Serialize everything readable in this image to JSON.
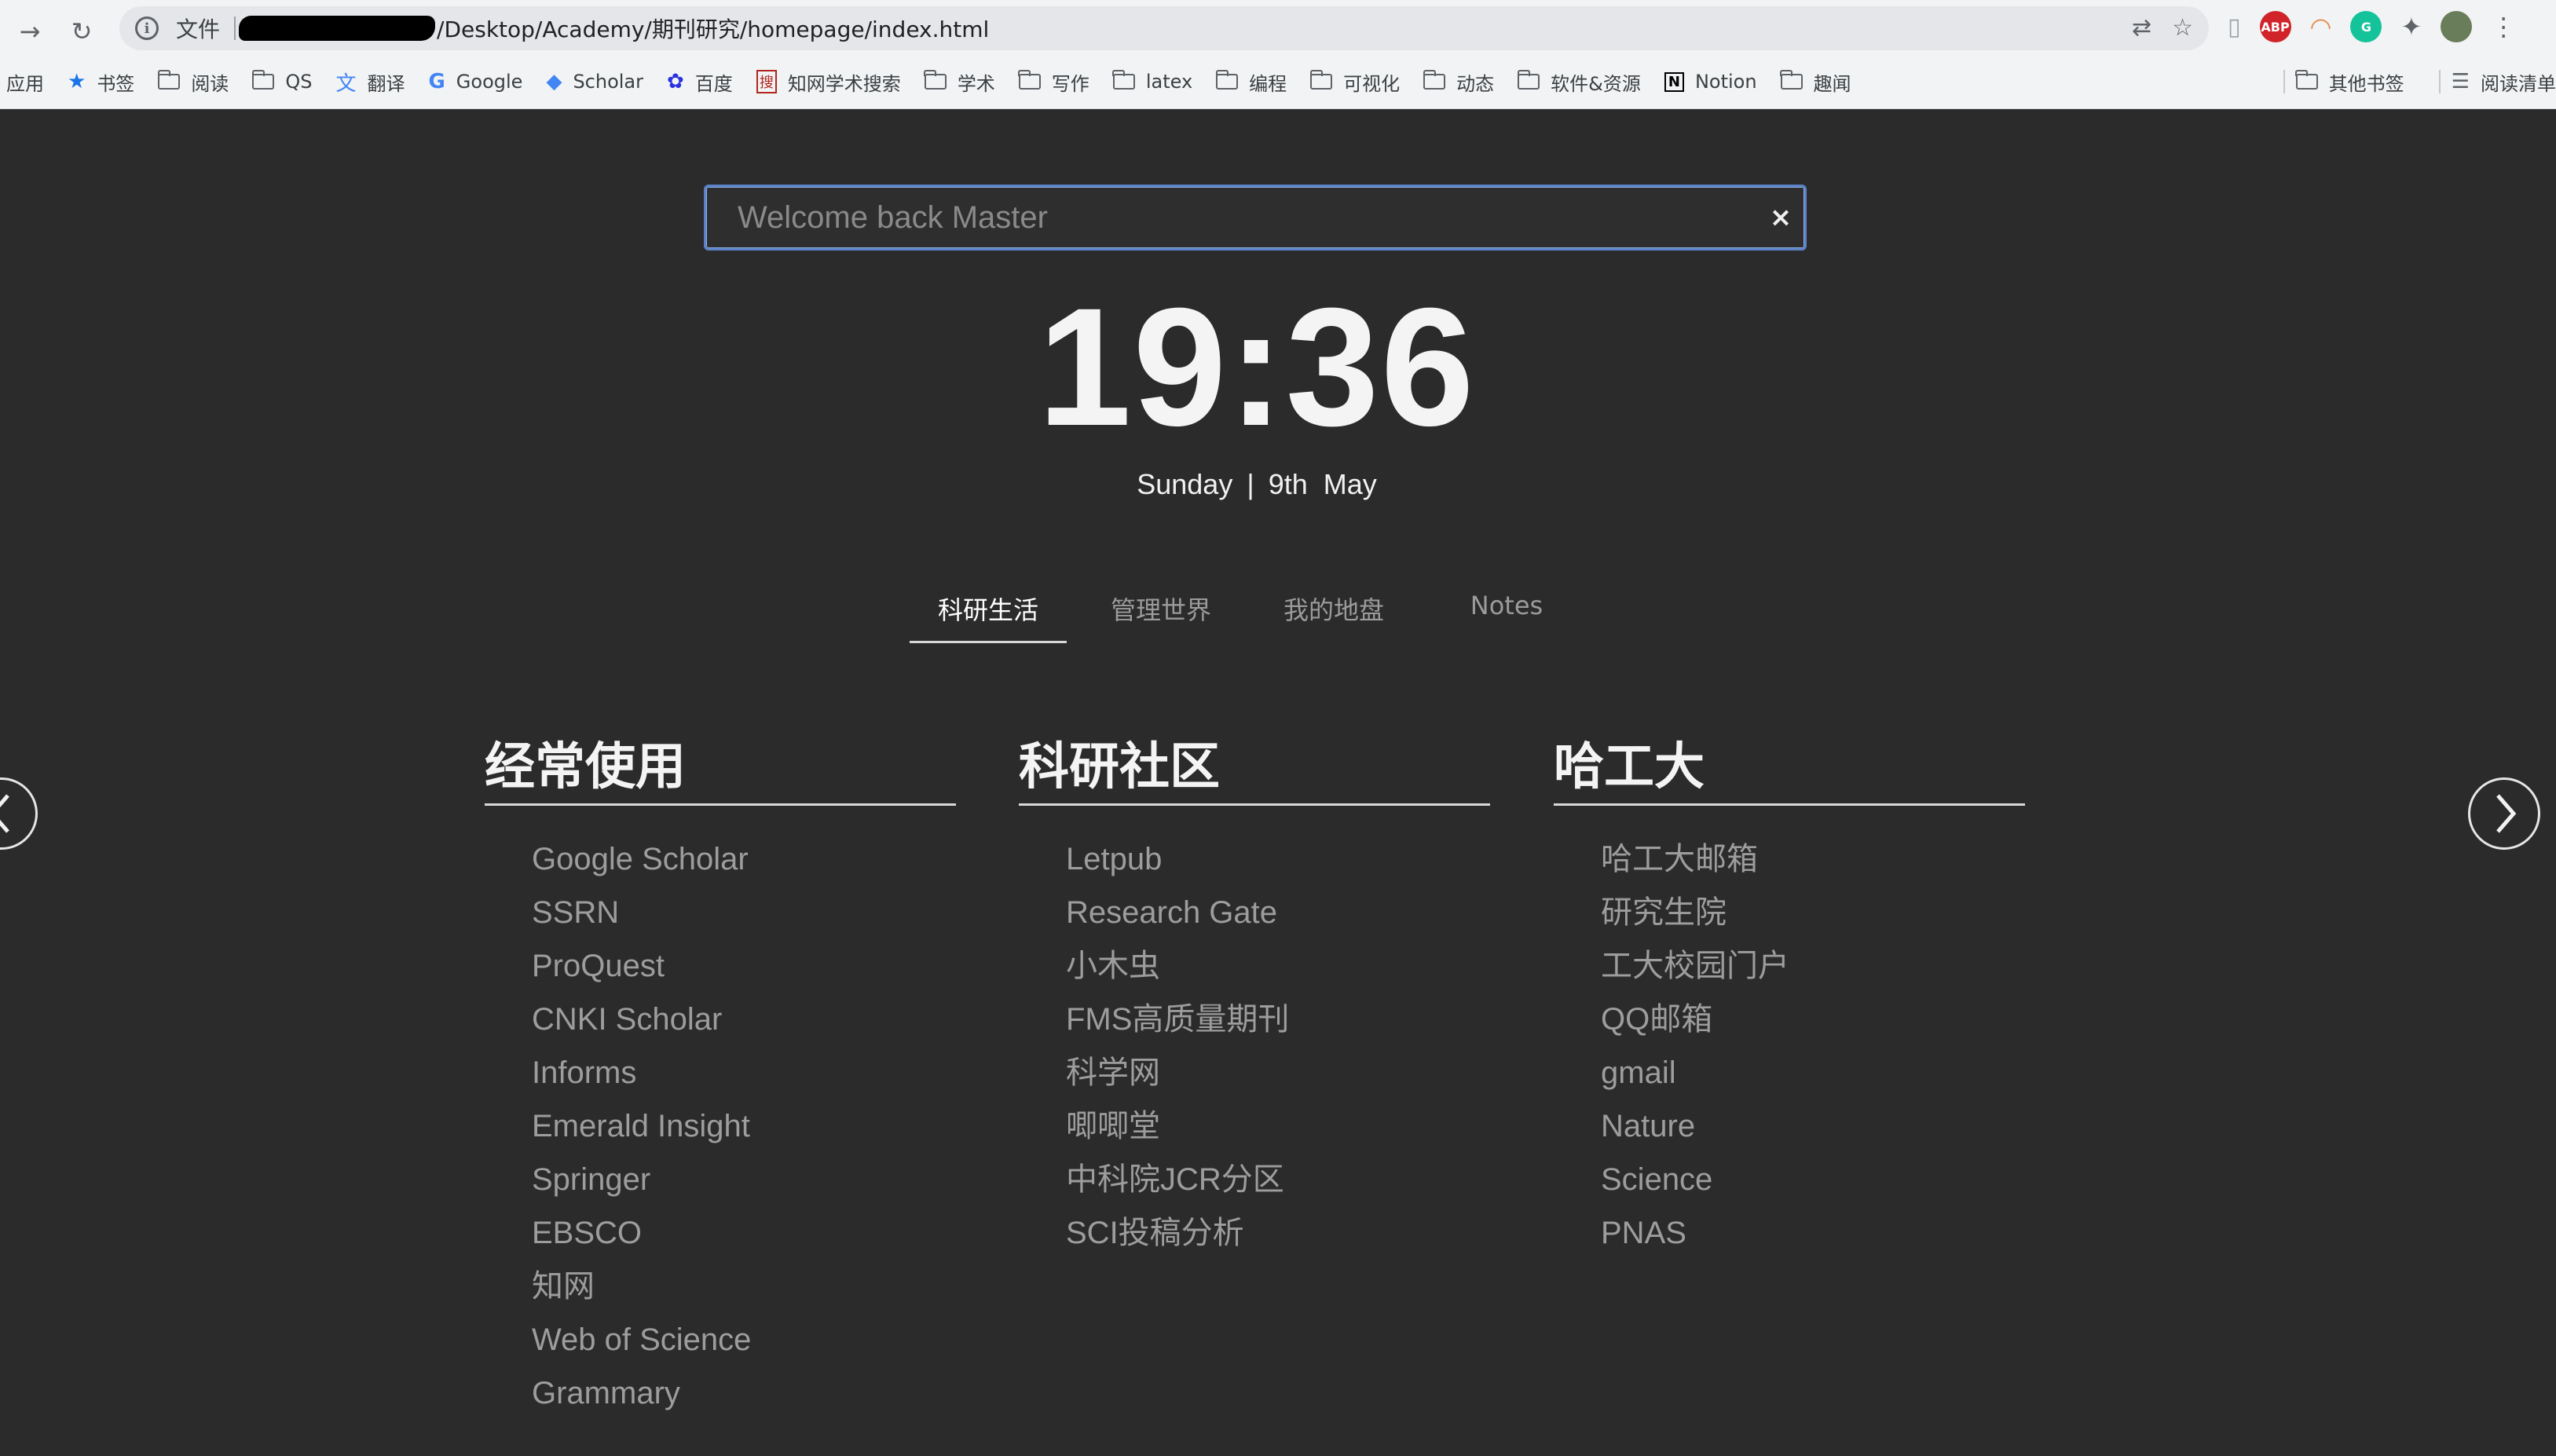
{
  "browser": {
    "scheme_label": "文件",
    "url": "/Desktop/Academy/期刊研究/homepage/index.html",
    "bookmarks": [
      "应用",
      "书签",
      "阅读",
      "QS",
      "翻译",
      "Google",
      "Scholar",
      "百度",
      "知网学术搜索",
      "学术",
      "写作",
      "latex",
      "编程",
      "可视化",
      "动态",
      "软件&资源",
      "Notion",
      "趣闻"
    ],
    "other_bookmarks": "其他书签",
    "reading_list": "阅读清单",
    "extensions": {
      "abp": "ABP",
      "grammarly": "G"
    }
  },
  "search": {
    "placeholder": "Welcome back Master",
    "clear": "×"
  },
  "clock": {
    "time": "19:36"
  },
  "date": {
    "weekday": "Sunday",
    "separator": "|",
    "day": "9th",
    "month": "May"
  },
  "tabs": [
    {
      "label": "科研生活",
      "active": true
    },
    {
      "label": "管理世界",
      "active": false
    },
    {
      "label": "我的地盘",
      "active": false
    },
    {
      "label": "Notes",
      "active": false
    }
  ],
  "columns": [
    {
      "title": "经常使用",
      "links": [
        "Google Scholar",
        "SSRN",
        "ProQuest",
        "CNKI Scholar",
        "Informs",
        "Emerald Insight",
        "Springer",
        "EBSCO",
        "知网",
        "Web of Science",
        "Grammary"
      ]
    },
    {
      "title": "科研社区",
      "links": [
        "Letpub",
        "Research Gate",
        "小木虫",
        "FMS高质量期刊",
        "科学网",
        "唧唧堂",
        "中科院JCR分区",
        "SCI投稿分析"
      ]
    },
    {
      "title": "哈工大",
      "links": [
        "哈工大邮箱",
        "研究生院",
        "工大校园门户",
        "QQ邮箱",
        "gmail",
        "Nature",
        "Science",
        "PNAS"
      ]
    }
  ],
  "colors": {
    "background": "#2b2b2b",
    "focus_border": "#5b82c8",
    "abp": "#d0232a",
    "grammarly": "#15c39a"
  }
}
